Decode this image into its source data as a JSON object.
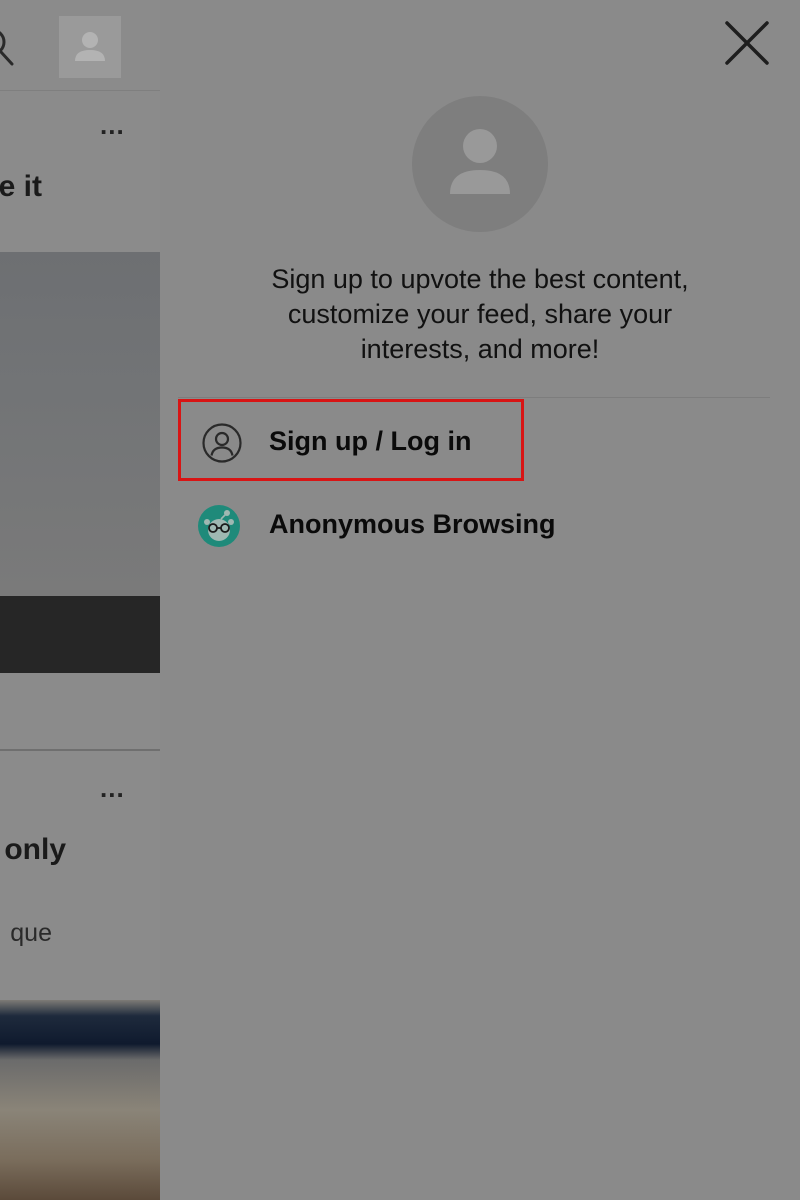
{
  "feed": {
    "post1": {
      "title_fragment": "e it",
      "more": "..."
    },
    "post2": {
      "title_fragment": "only",
      "subtitle_fragment": "que",
      "more": "..."
    }
  },
  "drawer": {
    "prompt_lines": [
      "Sign up to upvote the best content,",
      "customize your feed, share your",
      "interests, and more!"
    ],
    "menu": [
      {
        "label": "Sign up / Log in",
        "icon": "user-circle-icon"
      },
      {
        "label": "Anonymous Browsing",
        "icon": "anonymous-snoo-icon"
      }
    ]
  },
  "colors": {
    "overlay": "#8a8a8a",
    "highlight_border": "#d81414",
    "anon_icon": "#1f8a7a"
  }
}
